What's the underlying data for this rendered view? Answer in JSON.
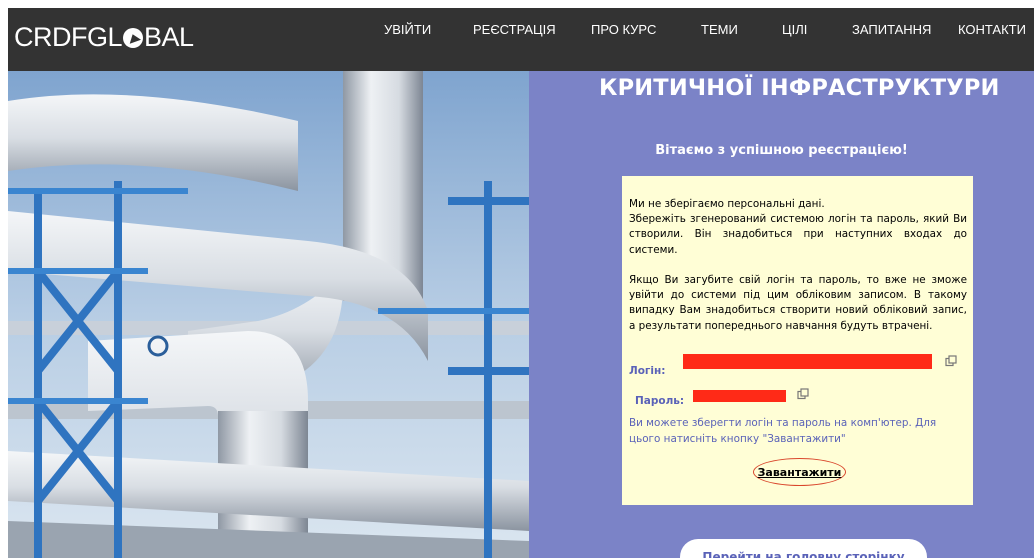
{
  "header": {
    "logo_text_before": "CRDFGL",
    "logo_text_after": "BAL",
    "nav": [
      "УВІЙТИ",
      "РЕЄСТРАЦІЯ",
      "ПРО КУРС",
      "ТЕМИ",
      "ЦІЛІ",
      "ЗАПИТАННЯ",
      "КОНТАКТИ"
    ]
  },
  "panel": {
    "title": "КРИТИЧНОЇ ІНФРАСТРУКТУРИ",
    "subtitle": "Вітаємо з успішною реєстрацією!",
    "notice": {
      "line1": "Ми не зберігаємо персональні дані.",
      "line2": "Збережіть згенерований системою логін та пароль, який Ви створили. Він знадобиться при наступних входах до системи.",
      "paragraph2": "Якщо Ви загубите свій логін та пароль, то вже не зможе увійти до системи під цим обліковим записом. В такому випадку Вам знадобиться створити новий обліковий запис, а результати попереднього навчання будуть втрачені."
    },
    "login_label": "Логін:",
    "password_label": "Пароль:",
    "save_hint": "Ви можете зберегти логін та пароль на комп'ютер. Для цього натисніть кнопку \"Завантажити\"",
    "download_label": "Завантажити",
    "home_button_label": "Перейти на головну сторінку"
  },
  "icons": {
    "copy_login": "copy-icon",
    "copy_password": "copy-icon"
  },
  "colors": {
    "header_bg": "#333333",
    "panel_bg": "#7b83c7",
    "card_bg": "#fffed6",
    "accent_text": "#5a62b8",
    "redaction": "#ff2a17",
    "download_outline": "#d9462c"
  }
}
